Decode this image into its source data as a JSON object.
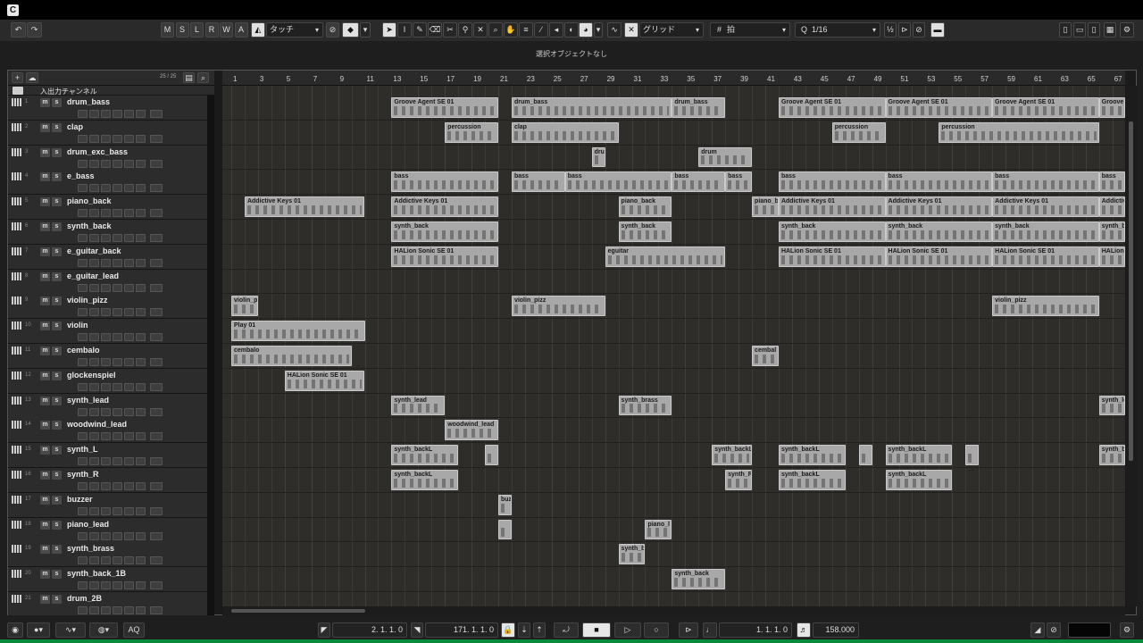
{
  "toolbar": {
    "undo": "↶",
    "redo": "↷",
    "state_buttons": [
      "M",
      "S",
      "L",
      "R",
      "W",
      "A"
    ],
    "automation_mode": "タッチ",
    "snap_type": "グリッド",
    "grid_type": "拍",
    "quantize": "1/16"
  },
  "info_line": {
    "text": "選択オブジェクトなし"
  },
  "track_header": {
    "count": "25 / 25",
    "add_label": "+"
  },
  "folder": {
    "label": "入出力チャンネル"
  },
  "tracks": [
    {
      "num": "1",
      "name": "drum_bass"
    },
    {
      "num": "2",
      "name": "clap"
    },
    {
      "num": "3",
      "name": "drum_exc_bass"
    },
    {
      "num": "4",
      "name": "e_bass"
    },
    {
      "num": "5",
      "name": "piano_back"
    },
    {
      "num": "6",
      "name": "synth_back"
    },
    {
      "num": "7",
      "name": "e_guitar_back"
    },
    {
      "num": "8",
      "name": "e_guitar_lead"
    },
    {
      "num": "9",
      "name": "violin_pizz"
    },
    {
      "num": "10",
      "name": "violin"
    },
    {
      "num": "11",
      "name": "cembalo"
    },
    {
      "num": "12",
      "name": "glockenspiel"
    },
    {
      "num": "13",
      "name": "synth_lead"
    },
    {
      "num": "14",
      "name": "woodwind_lead"
    },
    {
      "num": "15",
      "name": "synth_L"
    },
    {
      "num": "16",
      "name": "synth_R"
    },
    {
      "num": "17",
      "name": "buzzer"
    },
    {
      "num": "18",
      "name": "piano_lead"
    },
    {
      "num": "19",
      "name": "synth_brass"
    },
    {
      "num": "20",
      "name": "synth_back_1B"
    },
    {
      "num": "21",
      "name": "drum_2B"
    }
  ],
  "ruler": {
    "bars": [
      "1",
      "3",
      "5",
      "7",
      "9",
      "11",
      "13",
      "15",
      "17",
      "19",
      "21",
      "23",
      "25",
      "27",
      "29",
      "31",
      "33",
      "35",
      "37",
      "39",
      "41",
      "43",
      "45",
      "47",
      "49",
      "51",
      "53",
      "55",
      "57",
      "59",
      "61",
      "63",
      "65",
      "67"
    ]
  },
  "events": [
    {
      "track": 0,
      "start": 13,
      "len": 8,
      "label": "Groove Agent SE 01"
    },
    {
      "track": 0,
      "start": 22,
      "len": 12,
      "label": "drum_bass"
    },
    {
      "track": 0,
      "start": 34,
      "len": 4,
      "label": "drum_bass"
    },
    {
      "track": 0,
      "start": 42,
      "len": 8,
      "label": "Groove Agent SE 01"
    },
    {
      "track": 0,
      "start": 50,
      "len": 8,
      "label": "Groove Agent SE 01"
    },
    {
      "track": 0,
      "start": 58,
      "len": 8,
      "label": "Groove Agent SE 01"
    },
    {
      "track": 0,
      "start": 66,
      "len": 3,
      "label": "Groove Ag"
    },
    {
      "track": 1,
      "start": 17,
      "len": 4,
      "label": "percussion"
    },
    {
      "track": 1,
      "start": 22,
      "len": 8,
      "label": "clap"
    },
    {
      "track": 1,
      "start": 46,
      "len": 4,
      "label": "percussion"
    },
    {
      "track": 1,
      "start": 54,
      "len": 12,
      "label": "percussion"
    },
    {
      "track": 2,
      "start": 28,
      "len": 1,
      "label": "dru"
    },
    {
      "track": 2,
      "start": 36,
      "len": 4,
      "label": "drum"
    },
    {
      "track": 3,
      "start": 13,
      "len": 8,
      "label": "bass"
    },
    {
      "track": 3,
      "start": 22,
      "len": 4,
      "label": "bass"
    },
    {
      "track": 3,
      "start": 26,
      "len": 8,
      "label": "bass"
    },
    {
      "track": 3,
      "start": 34,
      "len": 4,
      "label": "bass"
    },
    {
      "track": 3,
      "start": 38,
      "len": 2,
      "label": "bass"
    },
    {
      "track": 3,
      "start": 42,
      "len": 8,
      "label": "bass"
    },
    {
      "track": 3,
      "start": 50,
      "len": 8,
      "label": "bass"
    },
    {
      "track": 3,
      "start": 58,
      "len": 8,
      "label": "bass"
    },
    {
      "track": 3,
      "start": 66,
      "len": 3,
      "label": "bass"
    },
    {
      "track": 4,
      "start": 2,
      "len": 9,
      "label": "Addictive Keys 01"
    },
    {
      "track": 4,
      "start": 13,
      "len": 8,
      "label": "Addictive Keys 01"
    },
    {
      "track": 4,
      "start": 30,
      "len": 4,
      "label": "piano_back"
    },
    {
      "track": 4,
      "start": 40,
      "len": 2,
      "label": "piano_b"
    },
    {
      "track": 4,
      "start": 42,
      "len": 8,
      "label": "Addictive Keys 01"
    },
    {
      "track": 4,
      "start": 50,
      "len": 8,
      "label": "Addictive Keys 01"
    },
    {
      "track": 4,
      "start": 58,
      "len": 8,
      "label": "Addictive Keys 01"
    },
    {
      "track": 4,
      "start": 66,
      "len": 3,
      "label": "Addictive K"
    },
    {
      "track": 5,
      "start": 13,
      "len": 8,
      "label": "synth_back"
    },
    {
      "track": 5,
      "start": 30,
      "len": 4,
      "label": "synth_back"
    },
    {
      "track": 5,
      "start": 42,
      "len": 8,
      "label": "synth_back"
    },
    {
      "track": 5,
      "start": 50,
      "len": 8,
      "label": "synth_back"
    },
    {
      "track": 5,
      "start": 58,
      "len": 8,
      "label": "synth_back"
    },
    {
      "track": 5,
      "start": 66,
      "len": 3,
      "label": "synth_back"
    },
    {
      "track": 6,
      "start": 13,
      "len": 8,
      "label": "HALion Sonic SE 01"
    },
    {
      "track": 6,
      "start": 29,
      "len": 9,
      "label": "eguitar"
    },
    {
      "track": 6,
      "start": 42,
      "len": 8,
      "label": "HALion Sonic SE 01"
    },
    {
      "track": 6,
      "start": 50,
      "len": 8,
      "label": "HALion Sonic SE 01"
    },
    {
      "track": 6,
      "start": 58,
      "len": 8,
      "label": "HALion Sonic SE 01"
    },
    {
      "track": 6,
      "start": 66,
      "len": 3,
      "label": "HALion Son"
    },
    {
      "track": 8,
      "start": 1,
      "len": 2,
      "label": "violin_p"
    },
    {
      "track": 8,
      "start": 22,
      "len": 7,
      "label": "violin_pizz"
    },
    {
      "track": 8,
      "start": 58,
      "len": 8,
      "label": "violin_pizz"
    },
    {
      "track": 9,
      "start": 1,
      "len": 10,
      "label": "Play 01"
    },
    {
      "track": 10,
      "start": 1,
      "len": 9,
      "label": "cembalo"
    },
    {
      "track": 10,
      "start": 40,
      "len": 2,
      "label": "cembal"
    },
    {
      "track": 11,
      "start": 5,
      "len": 6,
      "label": "HALion Sonic SE 01"
    },
    {
      "track": 12,
      "start": 13,
      "len": 4,
      "label": "synth_lead"
    },
    {
      "track": 12,
      "start": 30,
      "len": 4,
      "label": "synth_brass"
    },
    {
      "track": 12,
      "start": 66,
      "len": 3,
      "label": "synth_lead"
    },
    {
      "track": 13,
      "start": 17,
      "len": 4,
      "label": "woodwind_lead"
    },
    {
      "track": 14,
      "start": 13,
      "len": 5,
      "label": "synth_backL"
    },
    {
      "track": 14,
      "start": 20,
      "len": 1,
      "label": ""
    },
    {
      "track": 14,
      "start": 37,
      "len": 3,
      "label": "synth_backL"
    },
    {
      "track": 14,
      "start": 42,
      "len": 5,
      "label": "synth_backL"
    },
    {
      "track": 14,
      "start": 48,
      "len": 1,
      "label": ""
    },
    {
      "track": 14,
      "start": 50,
      "len": 5,
      "label": "synth_backL"
    },
    {
      "track": 14,
      "start": 56,
      "len": 1,
      "label": ""
    },
    {
      "track": 14,
      "start": 66,
      "len": 3,
      "label": "synth_back"
    },
    {
      "track": 15,
      "start": 13,
      "len": 5,
      "label": "synth_backL"
    },
    {
      "track": 15,
      "start": 38,
      "len": 2,
      "label": "synth_R"
    },
    {
      "track": 15,
      "start": 42,
      "len": 5,
      "label": "synth_backL"
    },
    {
      "track": 15,
      "start": 50,
      "len": 5,
      "label": "synth_backL"
    },
    {
      "track": 16,
      "start": 21,
      "len": 1,
      "label": "buz"
    },
    {
      "track": 17,
      "start": 21,
      "len": 1,
      "label": ""
    },
    {
      "track": 17,
      "start": 32,
      "len": 2,
      "label": "piano_l"
    },
    {
      "track": 18,
      "start": 30,
      "len": 2,
      "label": "synth_b"
    },
    {
      "track": 19,
      "start": 34,
      "len": 4,
      "label": "synth_back"
    }
  ],
  "transport": {
    "left_locator": "2. 1. 1.   0",
    "right_locator": "171. 1. 1.   0",
    "position": "1. 1. 1.   0",
    "tempo": "158.000",
    "aq_label": "AQ"
  }
}
